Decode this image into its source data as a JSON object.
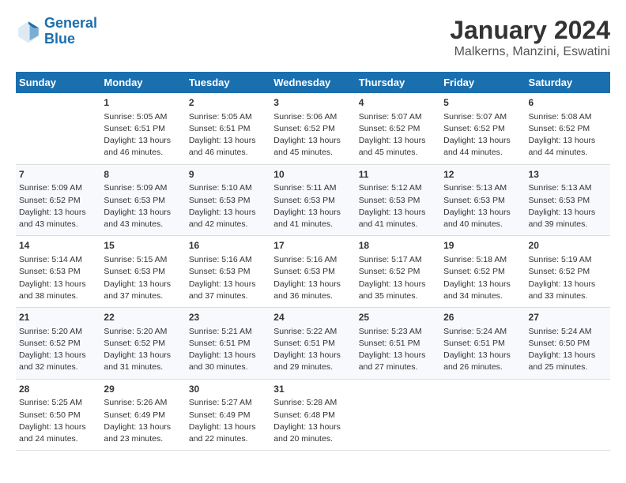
{
  "logo": {
    "line1": "General",
    "line2": "Blue"
  },
  "title": "January 2024",
  "subtitle": "Malkerns, Manzini, Eswatini",
  "headers": [
    "Sunday",
    "Monday",
    "Tuesday",
    "Wednesday",
    "Thursday",
    "Friday",
    "Saturday"
  ],
  "weeks": [
    [
      {
        "day": "",
        "info": ""
      },
      {
        "day": "1",
        "info": "Sunrise: 5:05 AM\nSunset: 6:51 PM\nDaylight: 13 hours\nand 46 minutes."
      },
      {
        "day": "2",
        "info": "Sunrise: 5:05 AM\nSunset: 6:51 PM\nDaylight: 13 hours\nand 46 minutes."
      },
      {
        "day": "3",
        "info": "Sunrise: 5:06 AM\nSunset: 6:52 PM\nDaylight: 13 hours\nand 45 minutes."
      },
      {
        "day": "4",
        "info": "Sunrise: 5:07 AM\nSunset: 6:52 PM\nDaylight: 13 hours\nand 45 minutes."
      },
      {
        "day": "5",
        "info": "Sunrise: 5:07 AM\nSunset: 6:52 PM\nDaylight: 13 hours\nand 44 minutes."
      },
      {
        "day": "6",
        "info": "Sunrise: 5:08 AM\nSunset: 6:52 PM\nDaylight: 13 hours\nand 44 minutes."
      }
    ],
    [
      {
        "day": "7",
        "info": "Sunrise: 5:09 AM\nSunset: 6:52 PM\nDaylight: 13 hours\nand 43 minutes."
      },
      {
        "day": "8",
        "info": "Sunrise: 5:09 AM\nSunset: 6:53 PM\nDaylight: 13 hours\nand 43 minutes."
      },
      {
        "day": "9",
        "info": "Sunrise: 5:10 AM\nSunset: 6:53 PM\nDaylight: 13 hours\nand 42 minutes."
      },
      {
        "day": "10",
        "info": "Sunrise: 5:11 AM\nSunset: 6:53 PM\nDaylight: 13 hours\nand 41 minutes."
      },
      {
        "day": "11",
        "info": "Sunrise: 5:12 AM\nSunset: 6:53 PM\nDaylight: 13 hours\nand 41 minutes."
      },
      {
        "day": "12",
        "info": "Sunrise: 5:13 AM\nSunset: 6:53 PM\nDaylight: 13 hours\nand 40 minutes."
      },
      {
        "day": "13",
        "info": "Sunrise: 5:13 AM\nSunset: 6:53 PM\nDaylight: 13 hours\nand 39 minutes."
      }
    ],
    [
      {
        "day": "14",
        "info": "Sunrise: 5:14 AM\nSunset: 6:53 PM\nDaylight: 13 hours\nand 38 minutes."
      },
      {
        "day": "15",
        "info": "Sunrise: 5:15 AM\nSunset: 6:53 PM\nDaylight: 13 hours\nand 37 minutes."
      },
      {
        "day": "16",
        "info": "Sunrise: 5:16 AM\nSunset: 6:53 PM\nDaylight: 13 hours\nand 37 minutes."
      },
      {
        "day": "17",
        "info": "Sunrise: 5:16 AM\nSunset: 6:53 PM\nDaylight: 13 hours\nand 36 minutes."
      },
      {
        "day": "18",
        "info": "Sunrise: 5:17 AM\nSunset: 6:52 PM\nDaylight: 13 hours\nand 35 minutes."
      },
      {
        "day": "19",
        "info": "Sunrise: 5:18 AM\nSunset: 6:52 PM\nDaylight: 13 hours\nand 34 minutes."
      },
      {
        "day": "20",
        "info": "Sunrise: 5:19 AM\nSunset: 6:52 PM\nDaylight: 13 hours\nand 33 minutes."
      }
    ],
    [
      {
        "day": "21",
        "info": "Sunrise: 5:20 AM\nSunset: 6:52 PM\nDaylight: 13 hours\nand 32 minutes."
      },
      {
        "day": "22",
        "info": "Sunrise: 5:20 AM\nSunset: 6:52 PM\nDaylight: 13 hours\nand 31 minutes."
      },
      {
        "day": "23",
        "info": "Sunrise: 5:21 AM\nSunset: 6:51 PM\nDaylight: 13 hours\nand 30 minutes."
      },
      {
        "day": "24",
        "info": "Sunrise: 5:22 AM\nSunset: 6:51 PM\nDaylight: 13 hours\nand 29 minutes."
      },
      {
        "day": "25",
        "info": "Sunrise: 5:23 AM\nSunset: 6:51 PM\nDaylight: 13 hours\nand 27 minutes."
      },
      {
        "day": "26",
        "info": "Sunrise: 5:24 AM\nSunset: 6:51 PM\nDaylight: 13 hours\nand 26 minutes."
      },
      {
        "day": "27",
        "info": "Sunrise: 5:24 AM\nSunset: 6:50 PM\nDaylight: 13 hours\nand 25 minutes."
      }
    ],
    [
      {
        "day": "28",
        "info": "Sunrise: 5:25 AM\nSunset: 6:50 PM\nDaylight: 13 hours\nand 24 minutes."
      },
      {
        "day": "29",
        "info": "Sunrise: 5:26 AM\nSunset: 6:49 PM\nDaylight: 13 hours\nand 23 minutes."
      },
      {
        "day": "30",
        "info": "Sunrise: 5:27 AM\nSunset: 6:49 PM\nDaylight: 13 hours\nand 22 minutes."
      },
      {
        "day": "31",
        "info": "Sunrise: 5:28 AM\nSunset: 6:48 PM\nDaylight: 13 hours\nand 20 minutes."
      },
      {
        "day": "",
        "info": ""
      },
      {
        "day": "",
        "info": ""
      },
      {
        "day": "",
        "info": ""
      }
    ]
  ]
}
